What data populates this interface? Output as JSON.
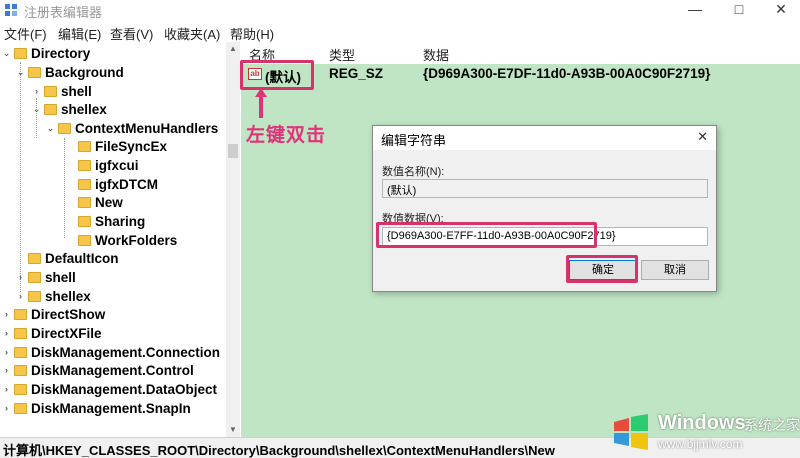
{
  "window": {
    "title": "注册表编辑器",
    "minimize_glyph": "—",
    "maximize_glyph": "□",
    "close_glyph": "✕"
  },
  "menu": [
    "文件(F)",
    "编辑(E)",
    "查看(V)",
    "收藏夹(A)",
    "帮助(H)"
  ],
  "tree": [
    {
      "label": "Directory",
      "expander": "⌄"
    },
    {
      "label": "Background",
      "expander": "⌄"
    },
    {
      "label": "shell",
      "expander": "›"
    },
    {
      "label": "shellex",
      "expander": "⌄"
    },
    {
      "label": "ContextMenuHandlers",
      "expander": "⌄"
    },
    {
      "label": "FileSyncEx",
      "expander": ""
    },
    {
      "label": "igfxcui",
      "expander": ""
    },
    {
      "label": "igfxDTCM",
      "expander": ""
    },
    {
      "label": "New",
      "expander": ""
    },
    {
      "label": "Sharing",
      "expander": ""
    },
    {
      "label": "WorkFolders",
      "expander": ""
    },
    {
      "label": "DefaultIcon",
      "expander": ""
    },
    {
      "label": "shell",
      "expander": "›"
    },
    {
      "label": "shellex",
      "expander": "›"
    },
    {
      "label": "DirectShow",
      "expander": "›"
    },
    {
      "label": "DirectXFile",
      "expander": "›"
    },
    {
      "label": "DiskManagement.Connection",
      "expander": "›"
    },
    {
      "label": "DiskManagement.Control",
      "expander": "›"
    },
    {
      "label": "DiskManagement.DataObject",
      "expander": "›"
    },
    {
      "label": "DiskManagement.SnapIn",
      "expander": "›"
    }
  ],
  "list": {
    "columns": [
      "名称",
      "类型",
      "数据"
    ],
    "rows": [
      {
        "icon_text": "ab",
        "name": "(默认)",
        "type": "REG_SZ",
        "data": "{D969A300-E7DF-11d0-A93B-00A0C90F2719}"
      }
    ]
  },
  "annotation": "左键双击",
  "dialog": {
    "title": "编辑字符串",
    "close_glyph": "✕",
    "name_label": "数值名称(N):",
    "name_value": "(默认)",
    "data_label": "数值数据(V):",
    "data_value": "{D969A300-E7FF-11d0-A93B-00A0C90F2719}",
    "ok_label": "确定",
    "cancel_label": "取消"
  },
  "status": "计算机\\HKEY_CLASSES_ROOT\\Directory\\Background\\shellex\\ContextMenuHandlers\\New",
  "watermark": {
    "brand": "Windows",
    "cn": "系统之家",
    "url": "www.bjjmlv.com"
  },
  "colors": {
    "highlight": "#d6336c",
    "list_background": "#bfe5c4",
    "annotation": "#e0337a"
  }
}
